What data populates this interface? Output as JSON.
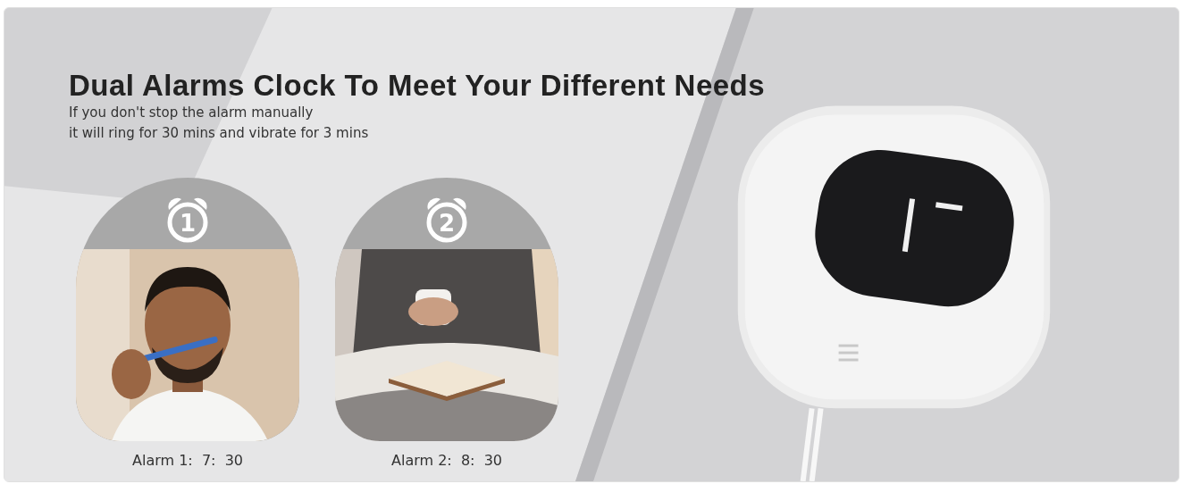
{
  "heading": "Dual Alarms Clock To Meet Your Different Needs",
  "subtitle": [
    "If you don't stop the alarm manually",
    "it will ring for 30 mins and vibrate for 3 mins"
  ],
  "alarms": [
    {
      "number": "1",
      "caption": "Alarm 1:  7:  30",
      "kind": "picture"
    },
    {
      "number": "2",
      "caption": "Alarm 2:  8:  30",
      "kind": "picture"
    }
  ]
}
